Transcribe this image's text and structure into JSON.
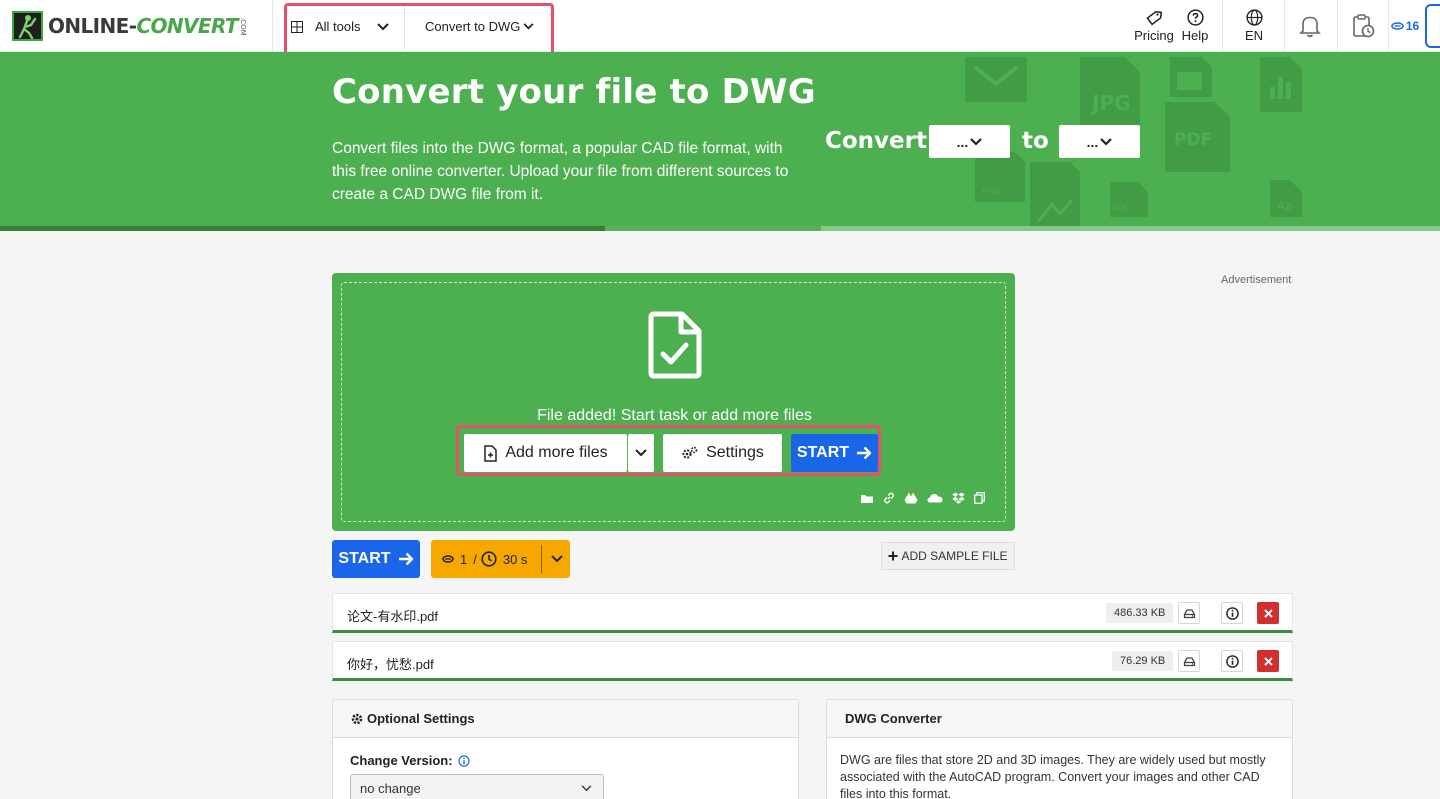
{
  "header": {
    "logo": {
      "brand_main": "ONLINE-",
      "brand_accent": "CONVERT",
      "brand_suffix": ".COM"
    },
    "all_tools_label": "All tools",
    "convert_menu_label": "Convert to DWG",
    "pricing_label": "Pricing",
    "help_label": "Help",
    "language_label": "EN",
    "credits_badge": "16"
  },
  "hero": {
    "title": "Convert your file to DWG",
    "description": "Convert files into the DWG format, a popular CAD file format, with this free online converter. Upload your file from different sources to create a CAD DWG file from it.",
    "convert_label": "Convert",
    "to_label": "to",
    "from_select_value": "...",
    "to_select_value": "...",
    "deco_labels": [
      "JPG",
      "PDF",
      "PNG",
      "DOC",
      "Aa"
    ]
  },
  "upload": {
    "advertisement_label": "Advertisement",
    "status_message": "File added! Start task or add more files",
    "add_files_label": "Add more files",
    "settings_label": "Settings",
    "start_label": "START"
  },
  "actions": {
    "start_label": "START",
    "credit_cost": "1",
    "credit_sep": "/",
    "time_estimate": "30 s",
    "add_sample_label": "ADD SAMPLE FILE"
  },
  "files": [
    {
      "name": "论文-有水印.pdf",
      "size": "486.33 KB"
    },
    {
      "name": "你好，忧愁.pdf",
      "size": "76.29 KB"
    }
  ],
  "optional_settings": {
    "title": "Optional Settings",
    "change_version_label": "Change Version:",
    "change_version_value": "no change"
  },
  "info_card": {
    "title": "DWG Converter",
    "body": "DWG are files that store 2D and 3D images. They are widely used but mostly associated with the AutoCAD program. Convert your images and other CAD files into this format."
  },
  "colors": {
    "brand_green": "#4caf50",
    "primary_blue": "#1a66e8",
    "credit_orange": "#f6a800",
    "delete_red": "#d32f2f",
    "highlight_outline": "#e8506a"
  }
}
